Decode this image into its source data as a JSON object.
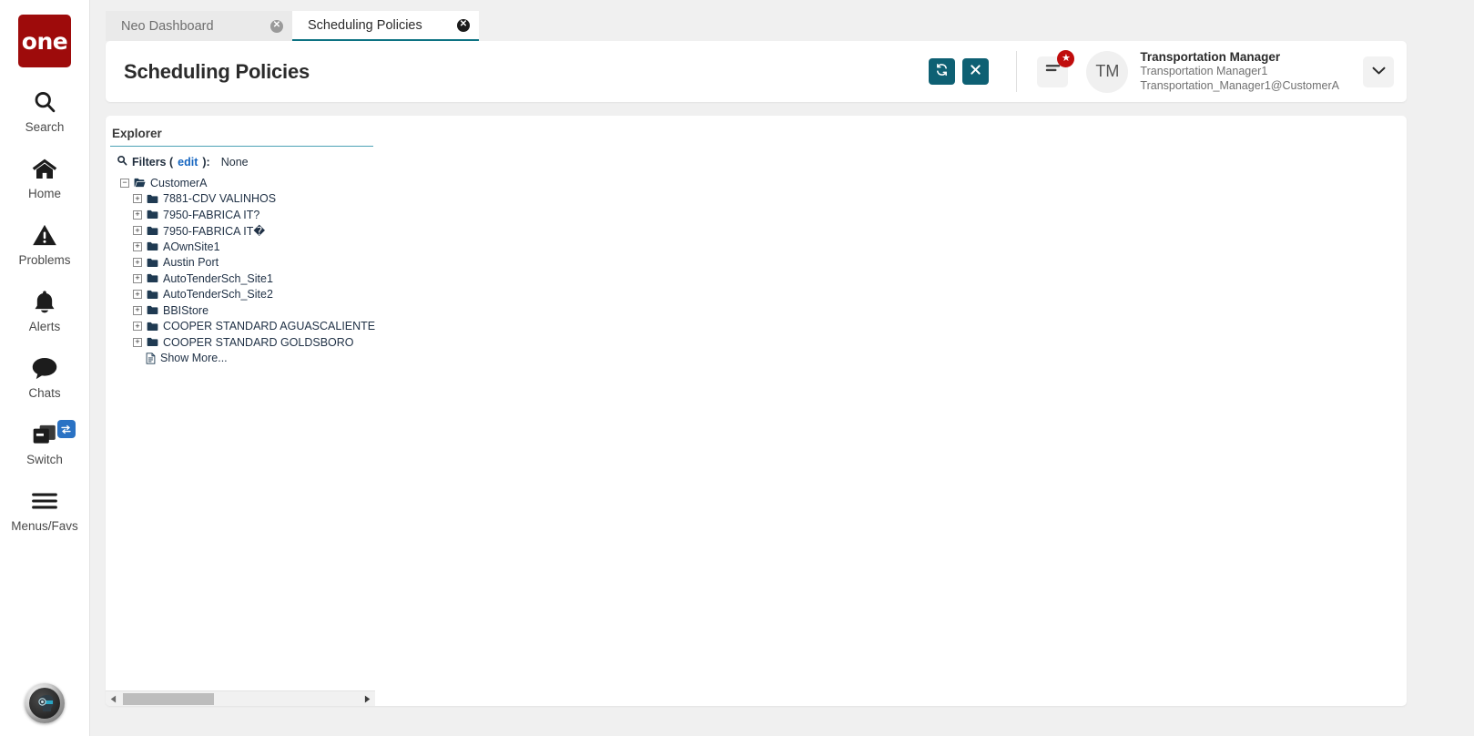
{
  "brand": {
    "logo_text": "one",
    "logo_color": "#9e0b0b"
  },
  "rail": {
    "items": [
      {
        "label": "Search",
        "icon": "search-icon"
      },
      {
        "label": "Home",
        "icon": "home-icon"
      },
      {
        "label": "Problems",
        "icon": "warning-triangle-icon"
      },
      {
        "label": "Alerts",
        "icon": "bell-icon"
      },
      {
        "label": "Chats",
        "icon": "chat-bubble-icon"
      },
      {
        "label": "Switch",
        "icon": "windows-stack-icon",
        "badge_icon": "swap-arrows-icon",
        "badge_color": "#2a72c4"
      },
      {
        "label": "Menus/Favs",
        "icon": "hamburger-icon"
      }
    ],
    "assistant_icon": "ai-assistant-orb-icon"
  },
  "tabs": [
    {
      "label": "Neo Dashboard",
      "active": false,
      "close_icon": "close-circle-icon"
    },
    {
      "label": "Scheduling Policies",
      "active": true,
      "close_icon": "close-circle-icon"
    }
  ],
  "header": {
    "title": "Scheduling Policies",
    "refresh_icon": "refresh-icon",
    "close_icon": "x-icon",
    "accent_color": "#0e6073",
    "menu_icon": "hamburger-menu-icon",
    "menu_badge_icon": "star-icon",
    "menu_badge_color": "#c00c0c",
    "avatar_initials": "TM",
    "user_role": "Transportation Manager",
    "user_name": "Transportation Manager1",
    "user_email": "Transportation_Manager1@CustomerA",
    "dropdown_icon": "chevron-down-icon"
  },
  "explorer": {
    "tab_label": "Explorer",
    "tab_underline_color": "#4da3b5",
    "filters": {
      "search_icon": "search-icon",
      "label": "Filters (",
      "edit_link": "edit",
      "label_end": "):",
      "value": "None"
    },
    "tree": [
      {
        "label": "CustomerA",
        "level": "root",
        "toggle": "minus",
        "icon": "folder-open-icon"
      },
      {
        "label": "7881-CDV VALINHOS",
        "level": "child",
        "toggle": "plus",
        "icon": "folder-icon"
      },
      {
        "label": "7950-FABRICA IT?",
        "level": "child",
        "toggle": "plus",
        "icon": "folder-icon"
      },
      {
        "label": "7950-FABRICA IT�",
        "level": "child",
        "toggle": "plus",
        "icon": "folder-icon"
      },
      {
        "label": "AOwnSite1",
        "level": "child",
        "toggle": "plus",
        "icon": "folder-icon"
      },
      {
        "label": "Austin Port",
        "level": "child",
        "toggle": "plus",
        "icon": "folder-icon"
      },
      {
        "label": "AutoTenderSch_Site1",
        "level": "child",
        "toggle": "plus",
        "icon": "folder-icon"
      },
      {
        "label": "AutoTenderSch_Site2",
        "level": "child",
        "toggle": "plus",
        "icon": "folder-icon"
      },
      {
        "label": "BBIStore",
        "level": "child",
        "toggle": "plus",
        "icon": "folder-icon"
      },
      {
        "label": "COOPER STANDARD AGUASCALIENTES",
        "level": "child",
        "toggle": "plus",
        "icon": "folder-icon"
      },
      {
        "label": "COOPER STANDARD GOLDSBORO",
        "level": "child",
        "toggle": "plus",
        "icon": "folder-icon"
      },
      {
        "label": "Show More...",
        "level": "leaf",
        "toggle": "none",
        "icon": "document-icon"
      }
    ],
    "scrollbar": {
      "left_icon": "triangle-left-icon",
      "right_icon": "triangle-right-icon"
    }
  }
}
